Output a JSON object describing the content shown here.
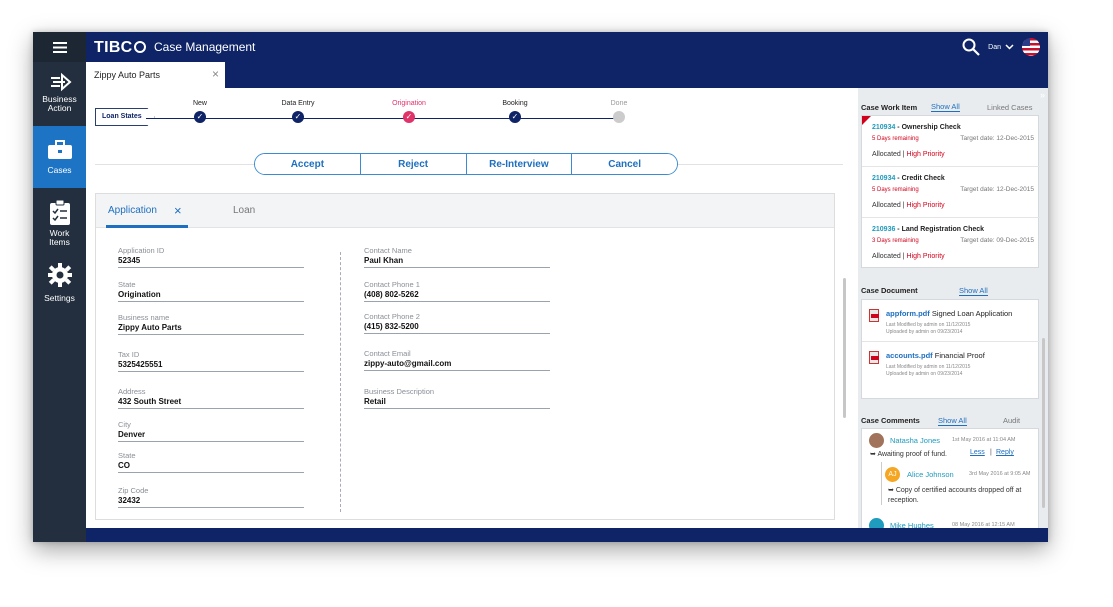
{
  "header": {
    "brand": "TIBC",
    "product": "Case Management",
    "user": "Dan"
  },
  "sidebar": {
    "items": [
      {
        "label": "Business Action",
        "icon": "business-action-icon"
      },
      {
        "label": "Cases",
        "icon": "briefcase-icon"
      },
      {
        "label": "Work Items",
        "icon": "clipboard-icon"
      },
      {
        "label": "Settings",
        "icon": "gear-icon"
      }
    ]
  },
  "case_tab": {
    "label": "Zippy Auto Parts"
  },
  "loan_states": {
    "label": "Loan States",
    "steps": [
      {
        "name": "New",
        "status": "done"
      },
      {
        "name": "Data Entry",
        "status": "done"
      },
      {
        "name": "Origination",
        "status": "current"
      },
      {
        "name": "Booking",
        "status": "done"
      },
      {
        "name": "Done",
        "status": "pending"
      }
    ]
  },
  "actions": [
    "Accept",
    "Reject",
    "Re-Interview",
    "Cancel"
  ],
  "form_tabs": [
    "Application",
    "Loan"
  ],
  "form": {
    "left": [
      {
        "label": "Application ID",
        "value": "52345"
      },
      {
        "label": "State",
        "value": "Origination"
      },
      {
        "label": "Business name",
        "value": "Zippy Auto Parts"
      },
      {
        "label": "Tax ID",
        "value": "5325425551"
      },
      {
        "label": "Address",
        "value": "432 South Street"
      },
      {
        "label": "City",
        "value": "Denver"
      },
      {
        "label": "State",
        "value": "CO"
      },
      {
        "label": "Zip Code",
        "value": "32432"
      }
    ],
    "right": [
      {
        "label": "Contact Name",
        "value": "Paul Khan"
      },
      {
        "label": "Contact Phone 1",
        "value": "(408) 802-5262"
      },
      {
        "label": "Contact Phone 2",
        "value": "(415) 832-5200"
      },
      {
        "label": "Contact Email",
        "value": "zippy-auto@gmail.com"
      },
      {
        "label": "Business Description",
        "value": "Retail"
      }
    ]
  },
  "work_items": {
    "title": "Case Work Item",
    "show_all": "Show All",
    "linked": "Linked Cases",
    "items": [
      {
        "id": "210934",
        "title": " - Ownership Check",
        "remaining": "5 Days remaining",
        "target": "Target date: 12-Dec-2015",
        "state": "Allocated | ",
        "priority": "High Priority"
      },
      {
        "id": "210934",
        "title": " - Credit Check",
        "remaining": "5 Days remaining",
        "target": "Target date: 12-Dec-2015",
        "state": "Allocated | ",
        "priority": "High Priority"
      },
      {
        "id": "210936",
        "title": " - Land Registration Check",
        "remaining": "3 Days remaining",
        "target": "Target date: 09-Dec-2015",
        "state": "Allocated | ",
        "priority": "High Priority"
      }
    ]
  },
  "documents": {
    "title": "Case Document",
    "show_all": "Show All",
    "items": [
      {
        "file": "appform.pdf",
        "desc": "Signed Loan Application",
        "modified": "Last Modified by admin on 11/12/2015",
        "uploaded": "Uploaded by admin on 09/23/2014"
      },
      {
        "file": "accounts.pdf",
        "desc": "Financial Proof",
        "modified": "Last Modified by admin on 11/12/2015",
        "uploaded": "Uploaded by admin on 09/23/2014"
      }
    ]
  },
  "comments": {
    "title": "Case Comments",
    "show_all": "Show All",
    "audit": "Audit",
    "items": [
      {
        "author": "Natasha Jones",
        "time": "1st May 2016 at 11:04 AM",
        "text": "Awaiting proof of fund.",
        "less": "Less",
        "reply": "Reply"
      },
      {
        "author": "Alice Johnson",
        "initials": "AJ",
        "time": "3rd May 2016 at 9:05 AM",
        "text": "Copy of certified accounts dropped off at reception."
      },
      {
        "author": "Mike Hughes",
        "time": "08 May 2016 at 12:15 AM"
      }
    ]
  },
  "colors": {
    "navy": "#0e2466",
    "accent": "#1e6fbf",
    "current_step": "#e0336a",
    "danger": "#d0021b"
  }
}
